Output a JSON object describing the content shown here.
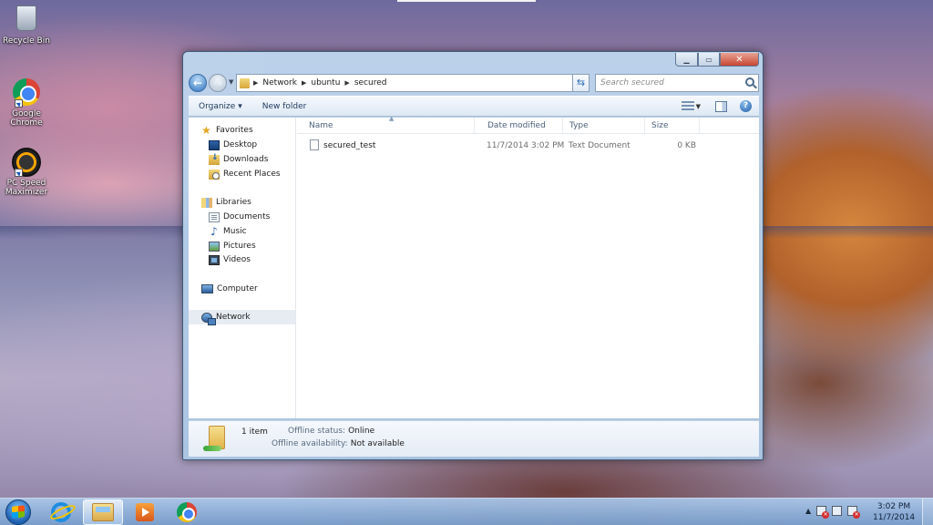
{
  "desktop": {
    "icons": [
      {
        "label": "Recycle Bin",
        "icon": "recycle-bin-icon"
      },
      {
        "label": "Google Chrome",
        "icon": "chrome-icon"
      },
      {
        "label": "PC Speed Maximizer",
        "icon": "pc-speed-maximizer-icon"
      }
    ]
  },
  "window": {
    "address": {
      "crumbs": [
        "Network",
        "ubuntu",
        "secured"
      ]
    },
    "search_placeholder": "Search secured",
    "toolbar": {
      "organize": "Organize",
      "new_folder": "New folder"
    },
    "nav": {
      "favorites": "Favorites",
      "desktop": "Desktop",
      "downloads": "Downloads",
      "recent_places": "Recent Places",
      "libraries": "Libraries",
      "documents": "Documents",
      "music": "Music",
      "pictures": "Pictures",
      "videos": "Videos",
      "computer": "Computer",
      "network": "Network"
    },
    "columns": {
      "name": "Name",
      "date_modified": "Date modified",
      "type": "Type",
      "size": "Size"
    },
    "files": [
      {
        "name": "secured_test",
        "date_modified": "11/7/2014 3:02 PM",
        "type": "Text Document",
        "size": "0 KB"
      }
    ],
    "details": {
      "count": "1 item",
      "offline_status_label": "Offline status:",
      "offline_status_value": "Online",
      "offline_availability_label": "Offline availability:",
      "offline_availability_value": "Not available"
    }
  },
  "taskbar": {
    "apps": [
      "internet-explorer-icon",
      "windows-explorer-icon",
      "media-player-icon",
      "chrome-icon"
    ],
    "clock_time": "3:02 PM",
    "clock_date": "11/7/2014"
  }
}
